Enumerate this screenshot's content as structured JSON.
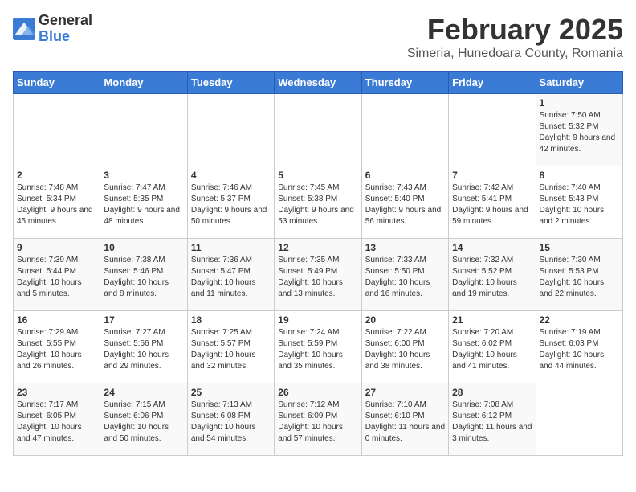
{
  "logo": {
    "general": "General",
    "blue": "Blue"
  },
  "title": "February 2025",
  "subtitle": "Simeria, Hunedoara County, Romania",
  "days_of_week": [
    "Sunday",
    "Monday",
    "Tuesday",
    "Wednesday",
    "Thursday",
    "Friday",
    "Saturday"
  ],
  "weeks": [
    [
      {
        "day": "",
        "info": ""
      },
      {
        "day": "",
        "info": ""
      },
      {
        "day": "",
        "info": ""
      },
      {
        "day": "",
        "info": ""
      },
      {
        "day": "",
        "info": ""
      },
      {
        "day": "",
        "info": ""
      },
      {
        "day": "1",
        "info": "Sunrise: 7:50 AM\nSunset: 5:32 PM\nDaylight: 9 hours and 42 minutes."
      }
    ],
    [
      {
        "day": "2",
        "info": "Sunrise: 7:48 AM\nSunset: 5:34 PM\nDaylight: 9 hours and 45 minutes."
      },
      {
        "day": "3",
        "info": "Sunrise: 7:47 AM\nSunset: 5:35 PM\nDaylight: 9 hours and 48 minutes."
      },
      {
        "day": "4",
        "info": "Sunrise: 7:46 AM\nSunset: 5:37 PM\nDaylight: 9 hours and 50 minutes."
      },
      {
        "day": "5",
        "info": "Sunrise: 7:45 AM\nSunset: 5:38 PM\nDaylight: 9 hours and 53 minutes."
      },
      {
        "day": "6",
        "info": "Sunrise: 7:43 AM\nSunset: 5:40 PM\nDaylight: 9 hours and 56 minutes."
      },
      {
        "day": "7",
        "info": "Sunrise: 7:42 AM\nSunset: 5:41 PM\nDaylight: 9 hours and 59 minutes."
      },
      {
        "day": "8",
        "info": "Sunrise: 7:40 AM\nSunset: 5:43 PM\nDaylight: 10 hours and 2 minutes."
      }
    ],
    [
      {
        "day": "9",
        "info": "Sunrise: 7:39 AM\nSunset: 5:44 PM\nDaylight: 10 hours and 5 minutes."
      },
      {
        "day": "10",
        "info": "Sunrise: 7:38 AM\nSunset: 5:46 PM\nDaylight: 10 hours and 8 minutes."
      },
      {
        "day": "11",
        "info": "Sunrise: 7:36 AM\nSunset: 5:47 PM\nDaylight: 10 hours and 11 minutes."
      },
      {
        "day": "12",
        "info": "Sunrise: 7:35 AM\nSunset: 5:49 PM\nDaylight: 10 hours and 13 minutes."
      },
      {
        "day": "13",
        "info": "Sunrise: 7:33 AM\nSunset: 5:50 PM\nDaylight: 10 hours and 16 minutes."
      },
      {
        "day": "14",
        "info": "Sunrise: 7:32 AM\nSunset: 5:52 PM\nDaylight: 10 hours and 19 minutes."
      },
      {
        "day": "15",
        "info": "Sunrise: 7:30 AM\nSunset: 5:53 PM\nDaylight: 10 hours and 22 minutes."
      }
    ],
    [
      {
        "day": "16",
        "info": "Sunrise: 7:29 AM\nSunset: 5:55 PM\nDaylight: 10 hours and 26 minutes."
      },
      {
        "day": "17",
        "info": "Sunrise: 7:27 AM\nSunset: 5:56 PM\nDaylight: 10 hours and 29 minutes."
      },
      {
        "day": "18",
        "info": "Sunrise: 7:25 AM\nSunset: 5:57 PM\nDaylight: 10 hours and 32 minutes."
      },
      {
        "day": "19",
        "info": "Sunrise: 7:24 AM\nSunset: 5:59 PM\nDaylight: 10 hours and 35 minutes."
      },
      {
        "day": "20",
        "info": "Sunrise: 7:22 AM\nSunset: 6:00 PM\nDaylight: 10 hours and 38 minutes."
      },
      {
        "day": "21",
        "info": "Sunrise: 7:20 AM\nSunset: 6:02 PM\nDaylight: 10 hours and 41 minutes."
      },
      {
        "day": "22",
        "info": "Sunrise: 7:19 AM\nSunset: 6:03 PM\nDaylight: 10 hours and 44 minutes."
      }
    ],
    [
      {
        "day": "23",
        "info": "Sunrise: 7:17 AM\nSunset: 6:05 PM\nDaylight: 10 hours and 47 minutes."
      },
      {
        "day": "24",
        "info": "Sunrise: 7:15 AM\nSunset: 6:06 PM\nDaylight: 10 hours and 50 minutes."
      },
      {
        "day": "25",
        "info": "Sunrise: 7:13 AM\nSunset: 6:08 PM\nDaylight: 10 hours and 54 minutes."
      },
      {
        "day": "26",
        "info": "Sunrise: 7:12 AM\nSunset: 6:09 PM\nDaylight: 10 hours and 57 minutes."
      },
      {
        "day": "27",
        "info": "Sunrise: 7:10 AM\nSunset: 6:10 PM\nDaylight: 11 hours and 0 minutes."
      },
      {
        "day": "28",
        "info": "Sunrise: 7:08 AM\nSunset: 6:12 PM\nDaylight: 11 hours and 3 minutes."
      },
      {
        "day": "",
        "info": ""
      }
    ]
  ]
}
